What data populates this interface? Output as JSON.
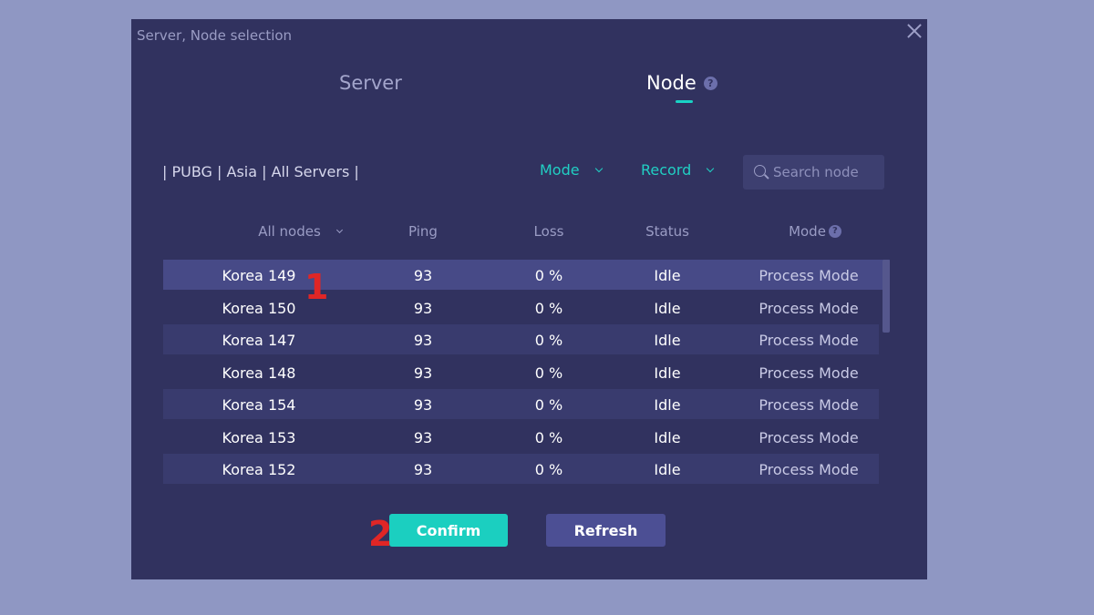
{
  "dialog": {
    "title": "Server, Node selection"
  },
  "tabs": {
    "server_label": "Server",
    "node_label": "Node",
    "help_glyph": "?"
  },
  "filters": {
    "breadcrumb": "| PUBG | Asia | All Servers |",
    "mode_label": "Mode",
    "record_label": "Record",
    "search_placeholder": "Search node"
  },
  "table": {
    "headers": {
      "name": "All nodes",
      "ping": "Ping",
      "loss": "Loss",
      "status": "Status",
      "mode": "Mode"
    },
    "rows": [
      {
        "name": "Korea 149",
        "ping": "93",
        "loss": "0 %",
        "status": "Idle",
        "mode": "Process Mode"
      },
      {
        "name": "Korea 150",
        "ping": "93",
        "loss": "0 %",
        "status": "Idle",
        "mode": "Process Mode"
      },
      {
        "name": "Korea 147",
        "ping": "93",
        "loss": "0 %",
        "status": "Idle",
        "mode": "Process Mode"
      },
      {
        "name": "Korea 148",
        "ping": "93",
        "loss": "0 %",
        "status": "Idle",
        "mode": "Process Mode"
      },
      {
        "name": "Korea 154",
        "ping": "93",
        "loss": "0 %",
        "status": "Idle",
        "mode": "Process Mode"
      },
      {
        "name": "Korea 153",
        "ping": "93",
        "loss": "0 %",
        "status": "Idle",
        "mode": "Process Mode"
      },
      {
        "name": "Korea 152",
        "ping": "93",
        "loss": "0 %",
        "status": "Idle",
        "mode": "Process Mode"
      }
    ]
  },
  "buttons": {
    "confirm": "Confirm",
    "refresh": "Refresh"
  },
  "annotations": {
    "marker_1": "1",
    "marker_2": "2"
  },
  "colors": {
    "background": "#8f97c3",
    "dialog": "#31325f",
    "accent": "#1bcfc0",
    "selected_row": "#474a87",
    "marker": "#e02626"
  }
}
